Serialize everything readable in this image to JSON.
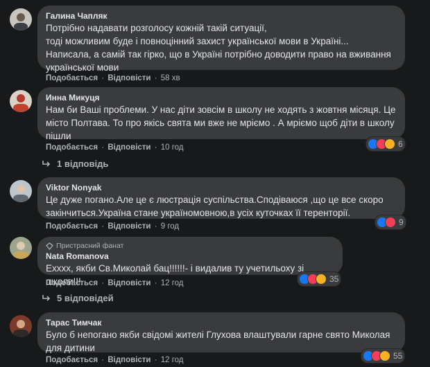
{
  "comments": [
    {
      "author": "Галина Чапляк",
      "lines": [
        "Потрібно надавати розголосу кожній такій ситуації,",
        "тоді можливим буде і повноцінний захист української мови в Україні...",
        "Написала, а самій так гірко, що в Україні потрібно доводити право на вживання",
        "української мови"
      ],
      "like_label": "Подобається",
      "reply_label": "Відповісти",
      "time": "58 хв"
    },
    {
      "author": "Инна Микуця",
      "lines": [
        "Нам би Ваші проблеми. У нас діти зовсім в школу не ходять з жовтня місяця. Це",
        "місто Полтава. То про якісь свята ми вже не мріємо . А мріємо щоб діти в школу",
        "пішли"
      ],
      "like_label": "Подобається",
      "reply_label": "Відповісти",
      "time": "10 год",
      "reaction_count": "6",
      "replies_label": "1 відповідь"
    },
    {
      "author": "Viktor Nonyak",
      "lines": [
        "Це дуже погано.Але це є люстрація суспільства.Сподіваюся ,що це все скоро",
        "закінчиться.Україна стане україномовною,в усіх куточках її теренторії."
      ],
      "like_label": "Подобається",
      "reply_label": "Відповісти",
      "time": "9 год",
      "reaction_count": "9"
    },
    {
      "badge": "Пристрасний фанат",
      "author": "Nata Romanova",
      "lines": [
        "Ехххх, якби Св.Миколай бац!!!!!!- і видалив ту учетильоху зі школи!!!"
      ],
      "like_label": "Подобається",
      "reply_label": "Відповісти",
      "time": "12 год",
      "reaction_count": "35",
      "replies_label": "5 відповідей"
    },
    {
      "author": "Тарас Тимчак",
      "lines": [
        "Було б непогано якби свідомі жителі Глухова влаштували гарне свято Миколая",
        "для дитини"
      ],
      "like_label": "Подобається",
      "reply_label": "Відповісти",
      "time": "12 год",
      "reaction_count": "55"
    }
  ],
  "colors": {
    "background": "#18191a",
    "bubble": "#3a3b3c",
    "text": "#e4e6eb",
    "muted": "#b0b3b8",
    "like": "#1877f2",
    "love": "#f33e58",
    "wow": "#f7b125"
  }
}
